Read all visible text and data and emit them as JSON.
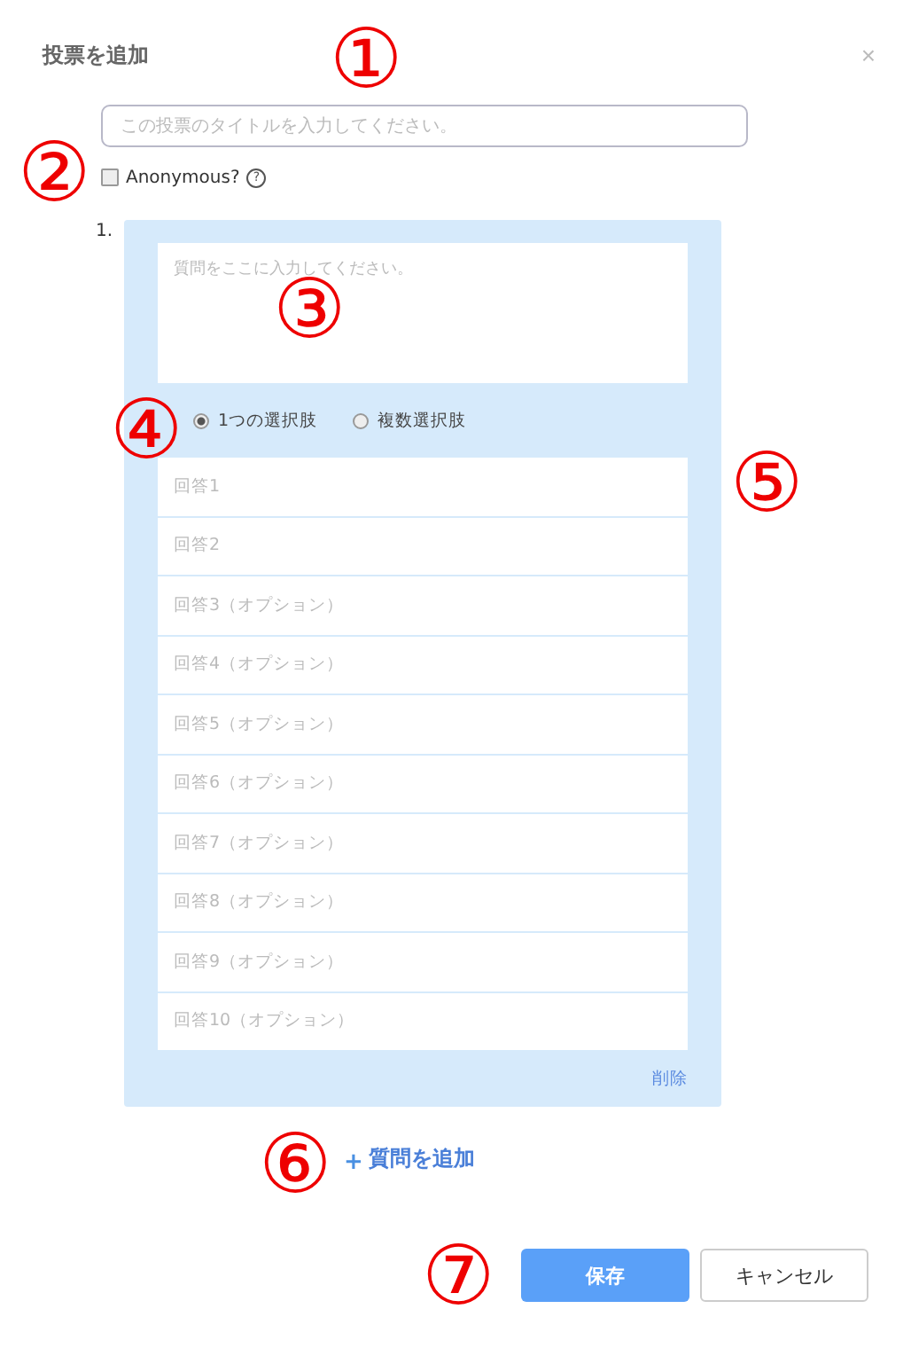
{
  "dialog": {
    "title": "投票を追加",
    "close": "×"
  },
  "poll_title": {
    "placeholder": "この投票のタイトルを入力してください。"
  },
  "anonymous": {
    "label": "Anonymous?",
    "checked": false,
    "help": "?"
  },
  "questions": [
    {
      "number": "1.",
      "question": {
        "placeholder": "質問をここに入力してください。"
      },
      "choice_types": [
        {
          "label": "1つの選択肢",
          "selected": true
        },
        {
          "label": "複数選択肢",
          "selected": false
        }
      ],
      "answers": [
        {
          "placeholder": "回答1"
        },
        {
          "placeholder": "回答2"
        },
        {
          "placeholder": "回答3（オプション）"
        },
        {
          "placeholder": "回答4（オプション）"
        },
        {
          "placeholder": "回答5（オプション）"
        },
        {
          "placeholder": "回答6（オプション）"
        },
        {
          "placeholder": "回答7（オプション）"
        },
        {
          "placeholder": "回答8（オプション）"
        },
        {
          "placeholder": "回答9（オプション）"
        },
        {
          "placeholder": "回答10（オプション）"
        }
      ],
      "delete": "削除"
    }
  ],
  "add_question": {
    "icon": "+",
    "label": "質問を追加"
  },
  "buttons": [
    {
      "label": "保存",
      "kind": "primary"
    },
    {
      "label": "キャンセル",
      "kind": "secondary"
    }
  ],
  "annotations": [
    {
      "text": "①"
    },
    {
      "text": "②"
    },
    {
      "text": "③"
    },
    {
      "text": "④"
    },
    {
      "text": "⑤"
    },
    {
      "text": "⑥"
    },
    {
      "text": "⑦"
    }
  ]
}
